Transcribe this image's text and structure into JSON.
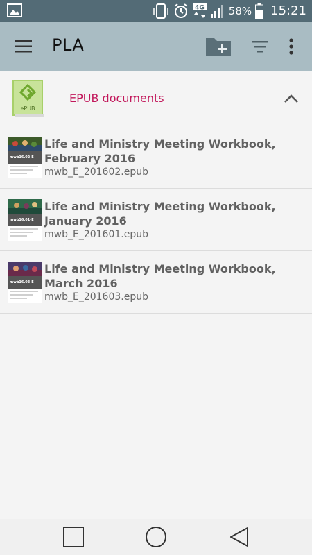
{
  "status_bar": {
    "network": "4G",
    "battery_percent": "58%",
    "time": "15:21"
  },
  "toolbar": {
    "title": "PLA",
    "icons": [
      "menu-icon",
      "add-folder-icon",
      "filter-icon",
      "more-vert-icon"
    ]
  },
  "group": {
    "logo_text": "ePUB",
    "title": "EPUB documents",
    "title_color": "#c2185b"
  },
  "documents": [
    {
      "title": "Life and Ministry Meeting Workbook, February 2016",
      "file": "mwb_E_201602.epub",
      "thumb_code": "mwb16.02-E"
    },
    {
      "title": "Life and Ministry Meeting Workbook, January 2016",
      "file": "mwb_E_201601.epub",
      "thumb_code": "mwb16.01-E"
    },
    {
      "title": "Life and Ministry Meeting Workbook, March 2016",
      "file": "mwb_E_201603.epub",
      "thumb_code": "mwb16.03-E"
    }
  ],
  "colors": {
    "status_bar": "#536b76",
    "toolbar": "#a9bcc3",
    "background": "#f4f4f4"
  }
}
